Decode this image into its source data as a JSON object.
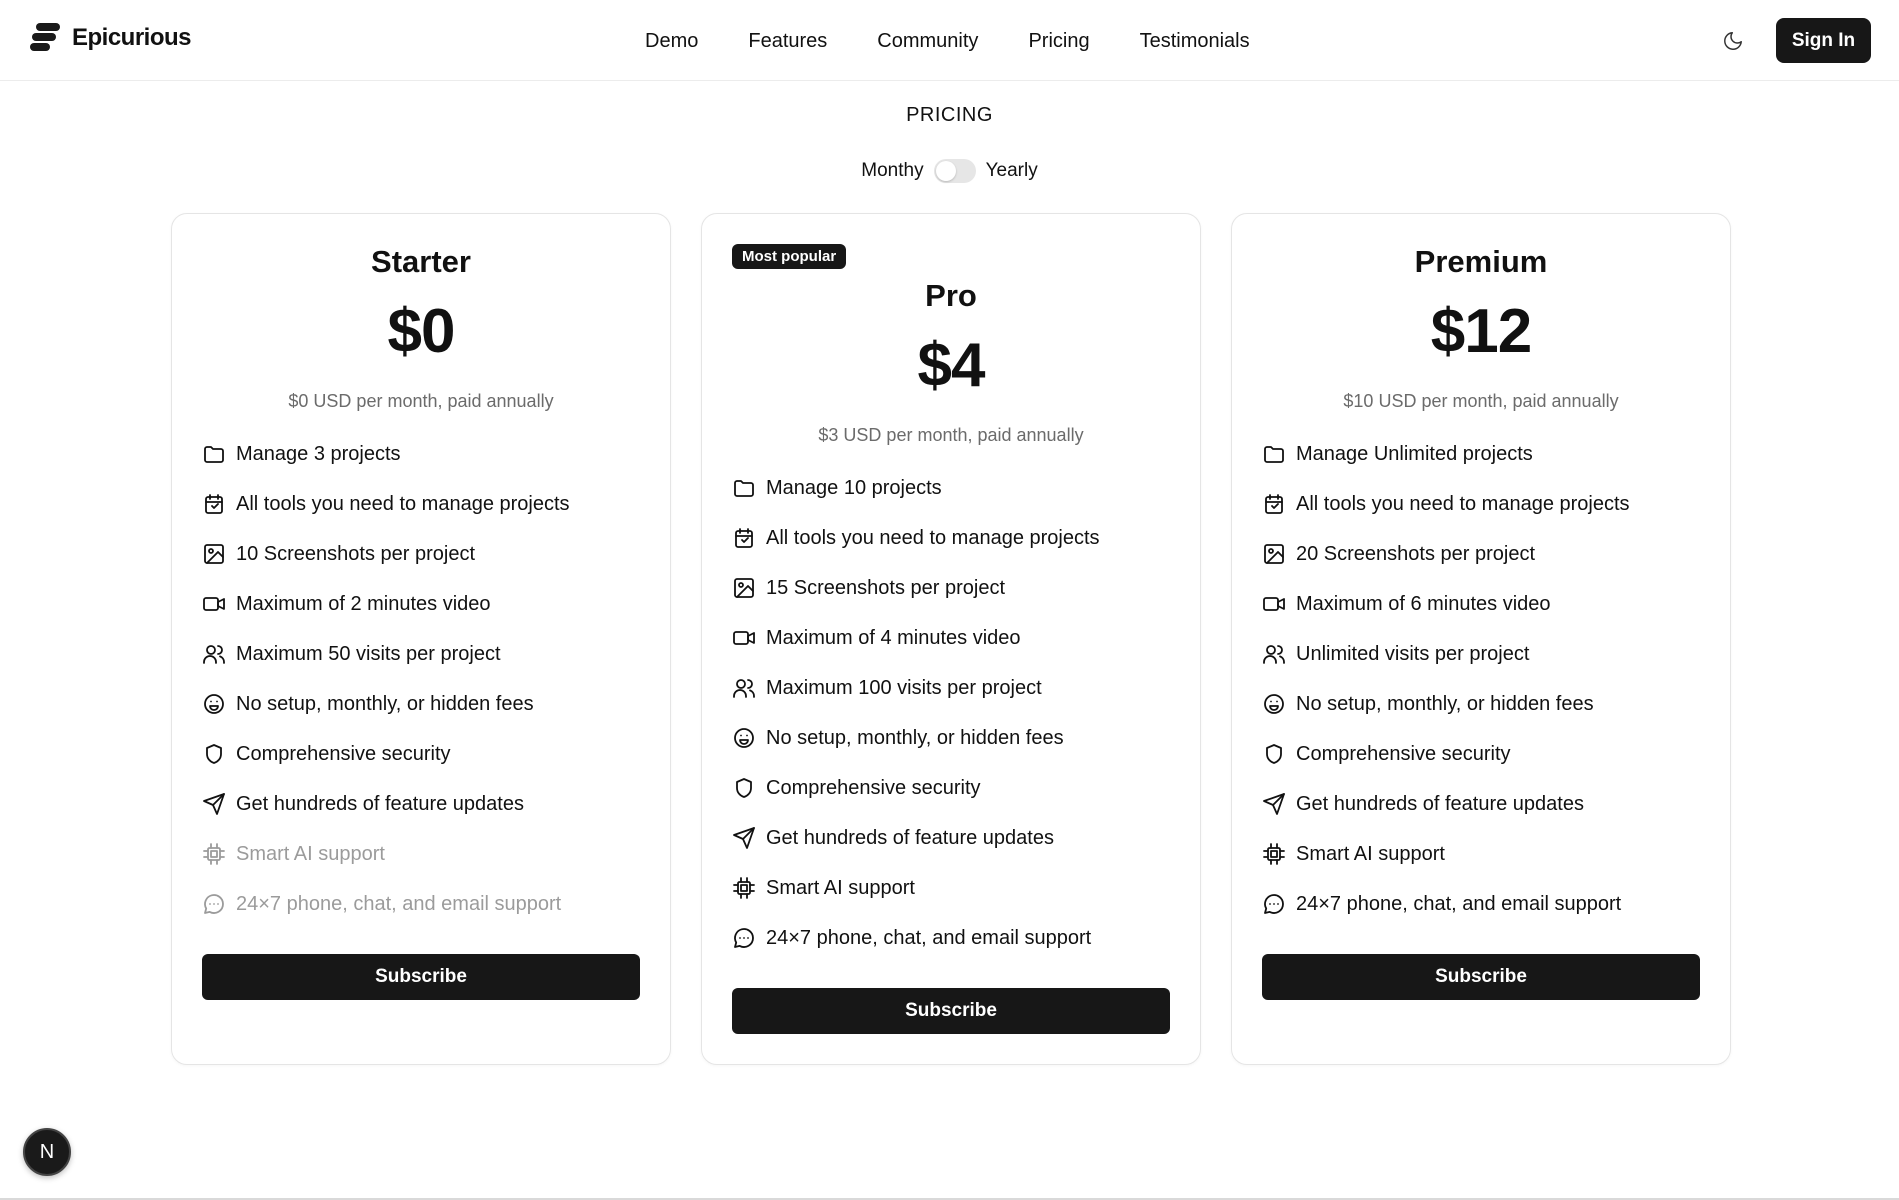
{
  "header": {
    "brand_name": "Epicurious",
    "nav": [
      "Demo",
      "Features",
      "Community",
      "Pricing",
      "Testimonials"
    ],
    "theme_icon": "moon-icon",
    "signin_label": "Sign In"
  },
  "pricing": {
    "eyebrow": "PRICING",
    "billing": {
      "monthly_label": "Monthy",
      "yearly_label": "Yearly",
      "yearly_selected": false
    }
  },
  "plans": [
    {
      "name": "Starter",
      "price": "$0",
      "note": "$0 USD per month, paid annually",
      "badge": "",
      "features": [
        {
          "icon": "folder-icon",
          "text": "Manage 3 projects",
          "included": true
        },
        {
          "icon": "calendar-icon",
          "text": "All tools you need to manage projects",
          "included": true
        },
        {
          "icon": "image-icon",
          "text": "10 Screenshots per project",
          "included": true
        },
        {
          "icon": "video-icon",
          "text": "Maximum of 2 minutes video",
          "included": true
        },
        {
          "icon": "users-icon",
          "text": "Maximum 50 visits per project",
          "included": true
        },
        {
          "icon": "smile-icon",
          "text": "No setup, monthly, or hidden fees",
          "included": true
        },
        {
          "icon": "shield-icon",
          "text": "Comprehensive security",
          "included": true
        },
        {
          "icon": "send-icon",
          "text": "Get hundreds of feature updates",
          "included": true
        },
        {
          "icon": "cpu-icon",
          "text": "Smart AI support",
          "included": false
        },
        {
          "icon": "chat-icon",
          "text": "24×7 phone, chat, and email support",
          "included": false
        }
      ],
      "cta": "Subscribe"
    },
    {
      "name": "Pro",
      "price": "$4",
      "note": "$3 USD per month, paid annually",
      "badge": "Most popular",
      "features": [
        {
          "icon": "folder-icon",
          "text": "Manage 10 projects",
          "included": true
        },
        {
          "icon": "calendar-icon",
          "text": "All tools you need to manage projects",
          "included": true
        },
        {
          "icon": "image-icon",
          "text": "15 Screenshots per project",
          "included": true
        },
        {
          "icon": "video-icon",
          "text": "Maximum of 4 minutes video",
          "included": true
        },
        {
          "icon": "users-icon",
          "text": "Maximum 100 visits per project",
          "included": true
        },
        {
          "icon": "smile-icon",
          "text": "No setup, monthly, or hidden fees",
          "included": true
        },
        {
          "icon": "shield-icon",
          "text": "Comprehensive security",
          "included": true
        },
        {
          "icon": "send-icon",
          "text": "Get hundreds of feature updates",
          "included": true
        },
        {
          "icon": "cpu-icon",
          "text": "Smart AI support",
          "included": true
        },
        {
          "icon": "chat-icon",
          "text": "24×7 phone, chat, and email support",
          "included": true
        }
      ],
      "cta": "Subscribe"
    },
    {
      "name": "Premium",
      "price": "$12",
      "note": "$10 USD per month, paid annually",
      "badge": "",
      "features": [
        {
          "icon": "folder-icon",
          "text": "Manage Unlimited projects",
          "included": true
        },
        {
          "icon": "calendar-icon",
          "text": "All tools you need to manage projects",
          "included": true
        },
        {
          "icon": "image-icon",
          "text": "20 Screenshots per project",
          "included": true
        },
        {
          "icon": "video-icon",
          "text": "Maximum of 6 minutes video",
          "included": true
        },
        {
          "icon": "users-icon",
          "text": "Unlimited visits per project",
          "included": true
        },
        {
          "icon": "smile-icon",
          "text": "No setup, monthly, or hidden fees",
          "included": true
        },
        {
          "icon": "shield-icon",
          "text": "Comprehensive security",
          "included": true
        },
        {
          "icon": "send-icon",
          "text": "Get hundreds of feature updates",
          "included": true
        },
        {
          "icon": "cpu-icon",
          "text": "Smart AI support",
          "included": true
        },
        {
          "icon": "chat-icon",
          "text": "24×7 phone, chat, and email support",
          "included": true
        }
      ],
      "cta": "Subscribe"
    }
  ],
  "dev_badge": "N",
  "colors": {
    "primary": "#171717",
    "muted_text": "#6b6b6b",
    "disabled_text": "#9b9b9b",
    "border": "#e5e5e5"
  }
}
